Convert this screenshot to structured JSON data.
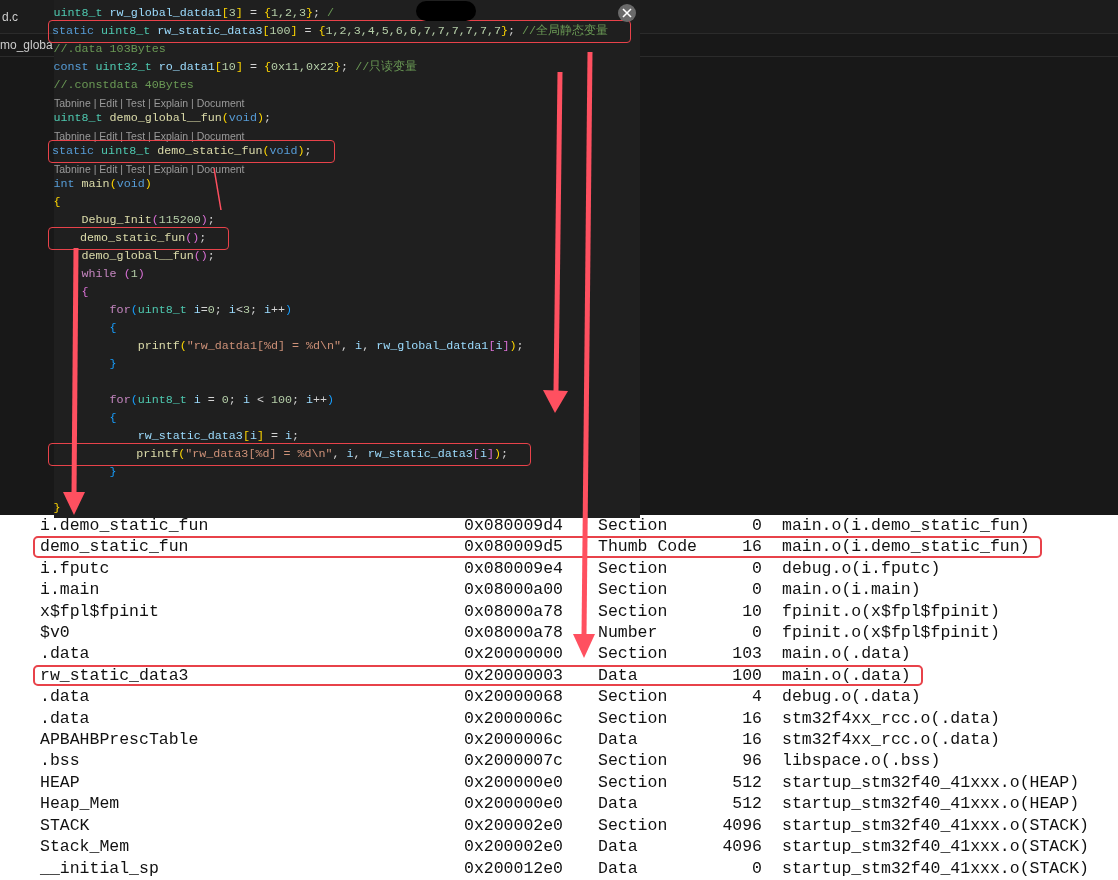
{
  "editor": {
    "tab": "d.c",
    "breadcrumb": "mo_globa"
  },
  "peek": {
    "lines": [
      {
        "kind": "code",
        "boxed": false,
        "tokens": [
          {
            "text": "uint8_t ",
            "kind": "type"
          },
          {
            "text": "rw_global_datda1",
            "kind": "var"
          },
          {
            "text": "[",
            "kind": "bracket"
          },
          {
            "text": "3",
            "kind": "num"
          },
          {
            "text": "]",
            "kind": "bracket"
          },
          {
            "text": " = ",
            "kind": "plain"
          },
          {
            "text": "{",
            "kind": "bracket"
          },
          {
            "text": "1,2,3",
            "kind": "num"
          },
          {
            "text": "}",
            "kind": "bracket"
          },
          {
            "text": "; ",
            "kind": "plain"
          },
          {
            "text": "/",
            "kind": "comment"
          }
        ]
      },
      {
        "kind": "code",
        "boxed": true,
        "tokens": [
          {
            "text": "static ",
            "kind": "keyword"
          },
          {
            "text": "uint8_t ",
            "kind": "type"
          },
          {
            "text": "rw_static_data3",
            "kind": "var"
          },
          {
            "text": "[",
            "kind": "bracket"
          },
          {
            "text": "100",
            "kind": "num"
          },
          {
            "text": "]",
            "kind": "bracket"
          },
          {
            "text": " = ",
            "kind": "plain"
          },
          {
            "text": "{",
            "kind": "bracket"
          },
          {
            "text": "1,2,3,4,5,6,6,7,7,7,7,7,7",
            "kind": "num"
          },
          {
            "text": "}",
            "kind": "bracket"
          },
          {
            "text": "; ",
            "kind": "plain"
          },
          {
            "text": "//全局静态变量",
            "kind": "comment"
          }
        ]
      },
      {
        "kind": "code",
        "boxed": false,
        "tokens": [
          {
            "text": "//.data 103Bytes",
            "kind": "comment"
          }
        ]
      },
      {
        "kind": "code",
        "boxed": false,
        "tokens": [
          {
            "text": "const ",
            "kind": "keyword"
          },
          {
            "text": "uint32_t ",
            "kind": "type"
          },
          {
            "text": "ro_data1",
            "kind": "var"
          },
          {
            "text": "[",
            "kind": "bracket"
          },
          {
            "text": "10",
            "kind": "num"
          },
          {
            "text": "]",
            "kind": "bracket"
          },
          {
            "text": " = ",
            "kind": "plain"
          },
          {
            "text": "{",
            "kind": "bracket"
          },
          {
            "text": "0x11,0x22",
            "kind": "num"
          },
          {
            "text": "}",
            "kind": "bracket"
          },
          {
            "text": "; ",
            "kind": "plain"
          },
          {
            "text": "//只读变量",
            "kind": "comment"
          }
        ]
      },
      {
        "kind": "code",
        "boxed": false,
        "tokens": [
          {
            "text": "//.constdata 40Bytes",
            "kind": "comment"
          }
        ]
      },
      {
        "kind": "codelens",
        "text": "Tabnine | Edit | Test | Explain | Document"
      },
      {
        "kind": "code",
        "boxed": false,
        "tokens": [
          {
            "text": "uint8_t ",
            "kind": "type"
          },
          {
            "text": "demo_global__fun",
            "kind": "func"
          },
          {
            "text": "(",
            "kind": "bracket"
          },
          {
            "text": "void",
            "kind": "keyword"
          },
          {
            "text": ")",
            "kind": "bracket"
          },
          {
            "text": ";",
            "kind": "plain"
          }
        ]
      },
      {
        "kind": "codelens",
        "text": "Tabnine | Edit | Test | Explain | Document"
      },
      {
        "kind": "code",
        "boxed": true,
        "tokens": [
          {
            "text": "static ",
            "kind": "keyword"
          },
          {
            "text": "uint8_t ",
            "kind": "type"
          },
          {
            "text": "demo_static_fun",
            "kind": "func"
          },
          {
            "text": "(",
            "kind": "bracket"
          },
          {
            "text": "void",
            "kind": "keyword"
          },
          {
            "text": ")",
            "kind": "bracket"
          },
          {
            "text": ";",
            "kind": "plain"
          }
        ]
      },
      {
        "kind": "codelens",
        "text": "Tabnine | Edit | Test | Explain | Document"
      },
      {
        "kind": "code",
        "boxed": false,
        "tokens": [
          {
            "text": "int ",
            "kind": "keyword"
          },
          {
            "text": "main",
            "kind": "func"
          },
          {
            "text": "(",
            "kind": "bracket"
          },
          {
            "text": "void",
            "kind": "keyword"
          },
          {
            "text": ")",
            "kind": "bracket"
          }
        ]
      },
      {
        "kind": "code",
        "boxed": false,
        "tokens": [
          {
            "text": "{",
            "kind": "bracket"
          }
        ]
      },
      {
        "kind": "code",
        "boxed": false,
        "tokens": [
          {
            "text": "    Debug_Init",
            "kind": "func"
          },
          {
            "text": "(",
            "kind": "bracket2"
          },
          {
            "text": "115200",
            "kind": "num"
          },
          {
            "text": ")",
            "kind": "bracket2"
          },
          {
            "text": ";",
            "kind": "plain"
          }
        ]
      },
      {
        "kind": "code",
        "boxed": true,
        "tokens": [
          {
            "text": "    demo_static_fun",
            "kind": "func"
          },
          {
            "text": "()",
            "kind": "bracket2"
          },
          {
            "text": ";",
            "kind": "plain"
          }
        ]
      },
      {
        "kind": "code",
        "boxed": false,
        "tokens": [
          {
            "text": "    demo_global__fun",
            "kind": "func"
          },
          {
            "text": "()",
            "kind": "bracket2"
          },
          {
            "text": ";",
            "kind": "plain"
          }
        ]
      },
      {
        "kind": "code",
        "boxed": false,
        "tokens": [
          {
            "text": "    while ",
            "kind": "control"
          },
          {
            "text": "(",
            "kind": "bracket2"
          },
          {
            "text": "1",
            "kind": "num"
          },
          {
            "text": ")",
            "kind": "bracket2"
          }
        ]
      },
      {
        "kind": "code",
        "boxed": false,
        "tokens": [
          {
            "text": "    {",
            "kind": "bracket2"
          }
        ]
      },
      {
        "kind": "code",
        "boxed": false,
        "tokens": [
          {
            "text": "        for",
            "kind": "control"
          },
          {
            "text": "(",
            "kind": "bracket3"
          },
          {
            "text": "uint8_t ",
            "kind": "type"
          },
          {
            "text": "i",
            "kind": "var"
          },
          {
            "text": "=",
            "kind": "plain"
          },
          {
            "text": "0",
            "kind": "num"
          },
          {
            "text": "; ",
            "kind": "plain"
          },
          {
            "text": "i",
            "kind": "var"
          },
          {
            "text": "<",
            "kind": "plain"
          },
          {
            "text": "3",
            "kind": "num"
          },
          {
            "text": "; ",
            "kind": "plain"
          },
          {
            "text": "i",
            "kind": "var"
          },
          {
            "text": "++",
            "kind": "plain"
          },
          {
            "text": ")",
            "kind": "bracket3"
          }
        ]
      },
      {
        "kind": "code",
        "boxed": false,
        "tokens": [
          {
            "text": "        {",
            "kind": "bracket3"
          }
        ]
      },
      {
        "kind": "code",
        "boxed": false,
        "tokens": [
          {
            "text": "            printf",
            "kind": "func"
          },
          {
            "text": "(",
            "kind": "bracket"
          },
          {
            "text": "\"rw_datda1[%d] = %d\\n\"",
            "kind": "string"
          },
          {
            "text": ", ",
            "kind": "plain"
          },
          {
            "text": "i",
            "kind": "var"
          },
          {
            "text": ", ",
            "kind": "plain"
          },
          {
            "text": "rw_global_datda1",
            "kind": "var"
          },
          {
            "text": "[",
            "kind": "bracket2"
          },
          {
            "text": "i",
            "kind": "var"
          },
          {
            "text": "]",
            "kind": "bracket2"
          },
          {
            "text": ")",
            "kind": "bracket"
          },
          {
            "text": ";",
            "kind": "plain"
          }
        ]
      },
      {
        "kind": "code",
        "boxed": false,
        "tokens": [
          {
            "text": "        }",
            "kind": "bracket3"
          }
        ]
      },
      {
        "kind": "blank"
      },
      {
        "kind": "code",
        "boxed": false,
        "tokens": [
          {
            "text": "        for",
            "kind": "control"
          },
          {
            "text": "(",
            "kind": "bracket3"
          },
          {
            "text": "uint8_t ",
            "kind": "type"
          },
          {
            "text": "i",
            "kind": "var"
          },
          {
            "text": " = ",
            "kind": "plain"
          },
          {
            "text": "0",
            "kind": "num"
          },
          {
            "text": "; ",
            "kind": "plain"
          },
          {
            "text": "i",
            "kind": "var"
          },
          {
            "text": " < ",
            "kind": "plain"
          },
          {
            "text": "100",
            "kind": "num"
          },
          {
            "text": "; ",
            "kind": "plain"
          },
          {
            "text": "i",
            "kind": "var"
          },
          {
            "text": "++",
            "kind": "plain"
          },
          {
            "text": ")",
            "kind": "bracket3"
          }
        ]
      },
      {
        "kind": "code",
        "boxed": false,
        "tokens": [
          {
            "text": "        {",
            "kind": "bracket3"
          }
        ]
      },
      {
        "kind": "code",
        "boxed": false,
        "tokens": [
          {
            "text": "            rw_static_data3",
            "kind": "var"
          },
          {
            "text": "[",
            "kind": "bracket"
          },
          {
            "text": "i",
            "kind": "var"
          },
          {
            "text": "]",
            "kind": "bracket"
          },
          {
            "text": " = ",
            "kind": "plain"
          },
          {
            "text": "i",
            "kind": "var"
          },
          {
            "text": ";",
            "kind": "plain"
          }
        ]
      },
      {
        "kind": "code",
        "boxed": true,
        "tokens": [
          {
            "text": "            printf",
            "kind": "func"
          },
          {
            "text": "(",
            "kind": "bracket"
          },
          {
            "text": "\"rw_data3[%d] = %d\\n\"",
            "kind": "string"
          },
          {
            "text": ", ",
            "kind": "plain"
          },
          {
            "text": "i",
            "kind": "var"
          },
          {
            "text": ", ",
            "kind": "plain"
          },
          {
            "text": "rw_static_data3",
            "kind": "var"
          },
          {
            "text": "[",
            "kind": "bracket2"
          },
          {
            "text": "i",
            "kind": "var"
          },
          {
            "text": "]",
            "kind": "bracket2"
          },
          {
            "text": ")",
            "kind": "bracket"
          },
          {
            "text": ";",
            "kind": "plain"
          }
        ]
      },
      {
        "kind": "code",
        "boxed": false,
        "tokens": [
          {
            "text": "        }",
            "kind": "bracket3"
          }
        ]
      },
      {
        "kind": "blank"
      },
      {
        "kind": "code",
        "boxed": false,
        "tokens": [
          {
            "text": "}",
            "kind": "bracket"
          }
        ]
      }
    ]
  },
  "map": {
    "rows": [
      {
        "symbol": "i.demo_static_fun",
        "address": "0x080009d4",
        "type": "Section",
        "size": "0",
        "object": "main.o(i.demo_static_fun)",
        "boxed": false
      },
      {
        "symbol": "demo_static_fun",
        "address": "0x080009d5",
        "type": "Thumb Code",
        "size": "16",
        "object": "main.o(i.demo_static_fun)",
        "boxed": true
      },
      {
        "symbol": "i.fputc",
        "address": "0x080009e4",
        "type": "Section",
        "size": "0",
        "object": "debug.o(i.fputc)",
        "boxed": false
      },
      {
        "symbol": "i.main",
        "address": "0x08000a00",
        "type": "Section",
        "size": "0",
        "object": "main.o(i.main)",
        "boxed": false
      },
      {
        "symbol": "x$fpl$fpinit",
        "address": "0x08000a78",
        "type": "Section",
        "size": "10",
        "object": "fpinit.o(x$fpl$fpinit)",
        "boxed": false
      },
      {
        "symbol": "$v0",
        "address": "0x08000a78",
        "type": "Number",
        "size": "0",
        "object": "fpinit.o(x$fpl$fpinit)",
        "boxed": false
      },
      {
        "symbol": ".data",
        "address": "0x20000000",
        "type": "Section",
        "size": "103",
        "object": "main.o(.data)",
        "boxed": false
      },
      {
        "symbol": "rw_static_data3",
        "address": "0x20000003",
        "type": "Data",
        "size": "100",
        "object": "main.o(.data)",
        "boxed": true
      },
      {
        "symbol": ".data",
        "address": "0x20000068",
        "type": "Section",
        "size": "4",
        "object": "debug.o(.data)",
        "boxed": false
      },
      {
        "symbol": ".data",
        "address": "0x2000006c",
        "type": "Section",
        "size": "16",
        "object": "stm32f4xx_rcc.o(.data)",
        "boxed": false
      },
      {
        "symbol": "APBAHBPrescTable",
        "address": "0x2000006c",
        "type": "Data",
        "size": "16",
        "object": "stm32f4xx_rcc.o(.data)",
        "boxed": false
      },
      {
        "symbol": ".bss",
        "address": "0x2000007c",
        "type": "Section",
        "size": "96",
        "object": "libspace.o(.bss)",
        "boxed": false
      },
      {
        "symbol": "HEAP",
        "address": "0x200000e0",
        "type": "Section",
        "size": "512",
        "object": "startup_stm32f40_41xxx.o(HEAP)",
        "boxed": false
      },
      {
        "symbol": "Heap_Mem",
        "address": "0x200000e0",
        "type": "Data",
        "size": "512",
        "object": "startup_stm32f40_41xxx.o(HEAP)",
        "boxed": false
      },
      {
        "symbol": "STACK",
        "address": "0x200002e0",
        "type": "Section",
        "size": "4096",
        "object": "startup_stm32f40_41xxx.o(STACK)",
        "boxed": false
      },
      {
        "symbol": "Stack_Mem",
        "address": "0x200002e0",
        "type": "Data",
        "size": "4096",
        "object": "startup_stm32f40_41xxx.o(STACK)",
        "boxed": false
      },
      {
        "symbol": "__initial_sp",
        "address": "0x200012e0",
        "type": "Data",
        "size": "0",
        "object": "startup_stm32f40_41xxx.o(STACK)",
        "boxed": false
      }
    ]
  }
}
